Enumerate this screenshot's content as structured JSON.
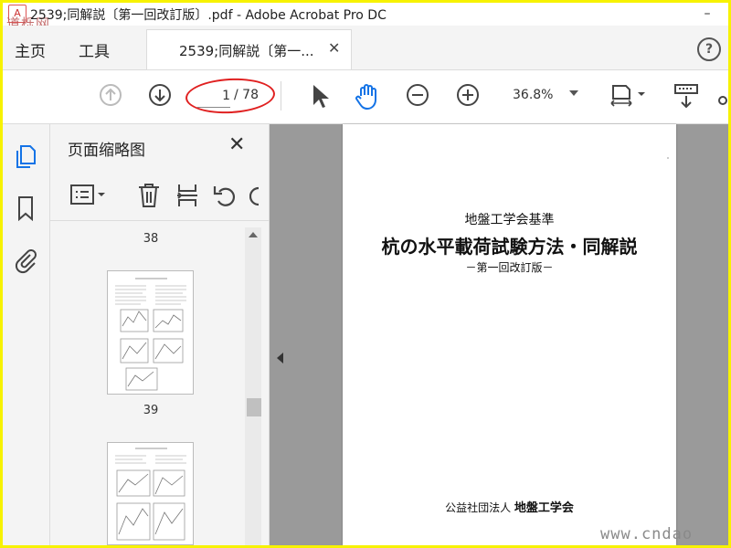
{
  "window": {
    "title": "2539;同解説〔第一回改訂版〕.pdf - Adobe Acrobat Pro DC",
    "minimize": "–",
    "watermark_logo": "道栎网"
  },
  "menubar": {
    "home": "主页",
    "tools": "工具",
    "tab_label": "2539;同解説〔第一...",
    "tab_close": "✕",
    "help": "?"
  },
  "toolbar": {
    "current_page": "1",
    "total_pages": "/ 78",
    "zoom": "36.8%"
  },
  "thumbnails": {
    "panel_title": "页面缩略图",
    "close": "✕",
    "pages": [
      "38",
      "39"
    ]
  },
  "document": {
    "line1": "地盤工学会基準",
    "line2": "杭の水平載荷試験方法・同解説",
    "line3": "－第一回改訂版－",
    "footer_prefix": "公益社団法人",
    "footer_org": "地盤工学会"
  },
  "overlay": {
    "site_watermark": "www.cndao"
  },
  "colors": {
    "frame_border": "#f7f200",
    "annotation_oval": "#e02020",
    "rail_active_icon": "#1473e6"
  }
}
